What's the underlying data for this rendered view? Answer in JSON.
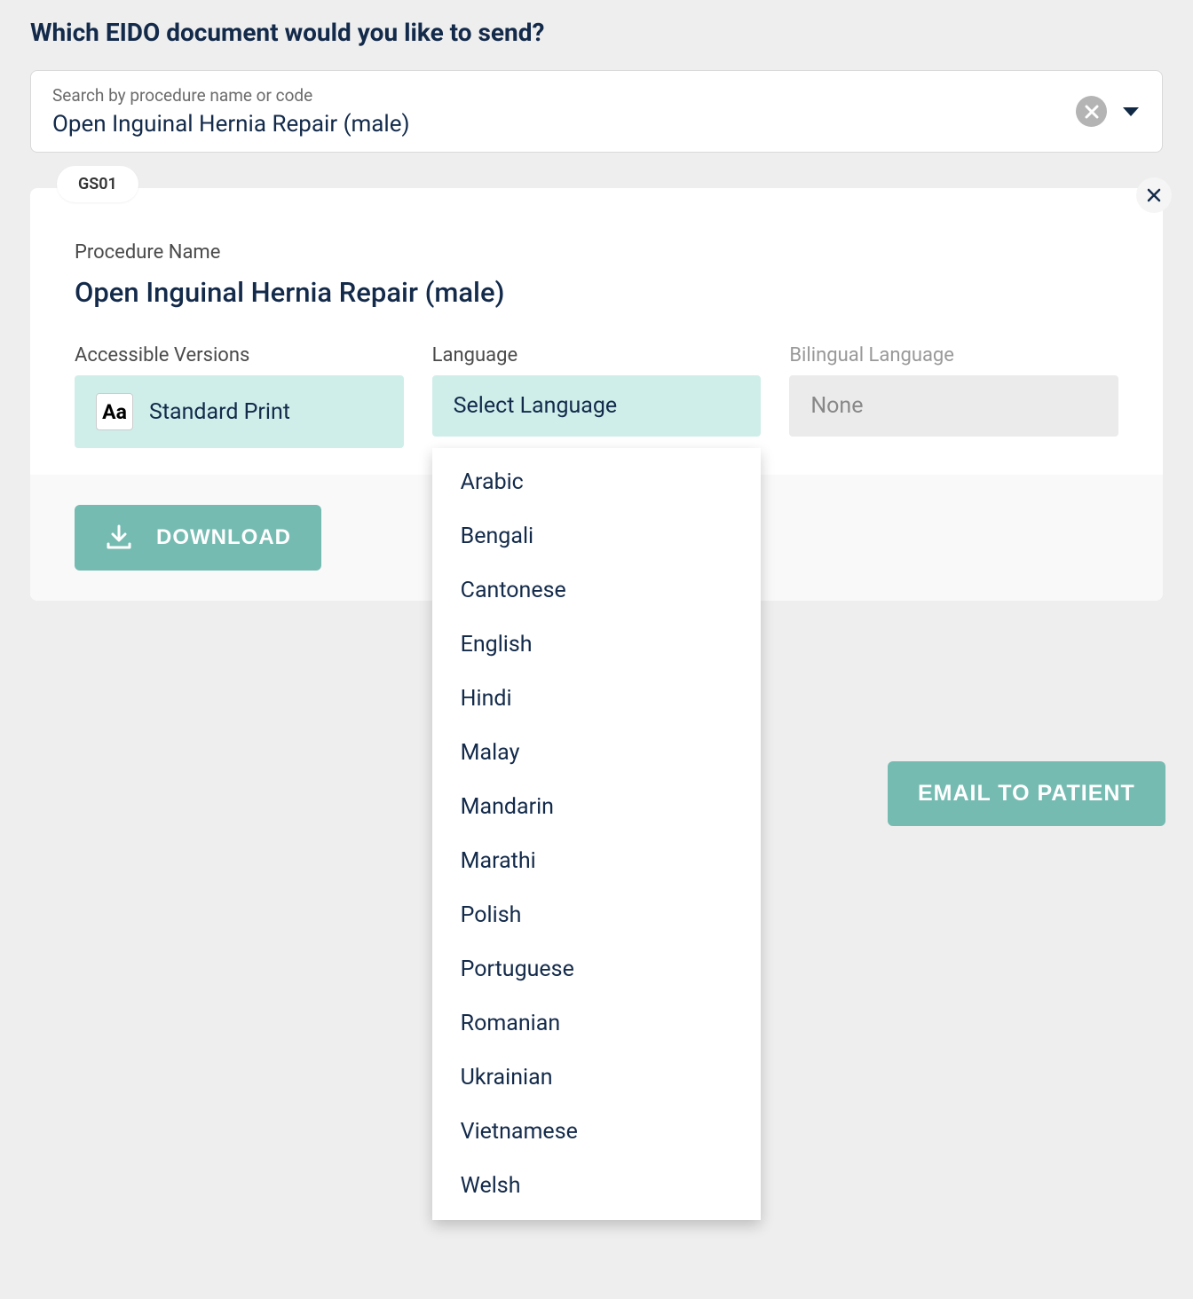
{
  "page_title": "Which EIDO document would you like to send?",
  "search": {
    "placeholder": "Search by procedure name or code",
    "value": "Open Inguinal Hernia Repair (male)"
  },
  "document": {
    "code": "GS01",
    "procedure_label": "Procedure Name",
    "procedure_name": "Open Inguinal Hernia Repair (male)",
    "sections": {
      "accessible": {
        "label": "Accessible Versions",
        "value": "Standard Print",
        "icon_text": "Aa"
      },
      "language": {
        "label": "Language",
        "value": "Select Language",
        "options": [
          "Arabic",
          "Bengali",
          "Cantonese",
          "English",
          "Hindi",
          "Malay",
          "Mandarin",
          "Marathi",
          "Polish",
          "Portuguese",
          "Romanian",
          "Ukrainian",
          "Vietnamese",
          "Welsh"
        ]
      },
      "bilingual": {
        "label": "Bilingual Language",
        "value": "None"
      }
    }
  },
  "buttons": {
    "download": "DOWNLOAD",
    "email": "EMAIL TO PATIENT"
  }
}
